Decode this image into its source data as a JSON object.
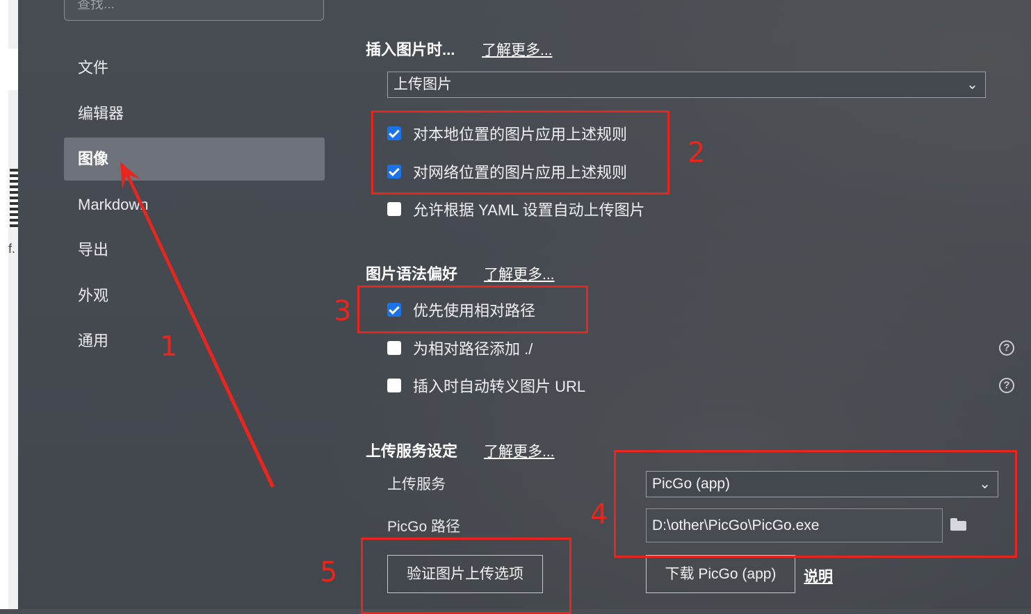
{
  "search": {
    "placeholder": "查找..."
  },
  "sidebar": {
    "items": [
      {
        "label": "文件",
        "active": false
      },
      {
        "label": "编辑器",
        "active": false
      },
      {
        "label": "图像",
        "active": true
      },
      {
        "label": "Markdown",
        "active": false
      },
      {
        "label": "导出",
        "active": false
      },
      {
        "label": "外观",
        "active": false
      },
      {
        "label": "通用",
        "active": false
      }
    ]
  },
  "insert_image": {
    "title": "插入图片时...",
    "learn_more": "了解更多...",
    "action_select": "上传图片",
    "options": [
      {
        "label": "对本地位置的图片应用上述规则",
        "checked": true
      },
      {
        "label": "对网络位置的图片应用上述规则",
        "checked": true
      },
      {
        "label": "允许根据 YAML 设置自动上传图片",
        "checked": false
      }
    ]
  },
  "syntax_pref": {
    "title": "图片语法偏好",
    "learn_more": "了解更多...",
    "options": [
      {
        "label": "优先使用相对路径",
        "checked": true,
        "help": false
      },
      {
        "label": "为相对路径添加 ./",
        "checked": false,
        "help": true
      },
      {
        "label": "插入时自动转义图片 URL",
        "checked": false,
        "help": true
      }
    ]
  },
  "upload_service": {
    "title": "上传服务设定",
    "learn_more": "了解更多...",
    "service_label": "上传服务",
    "service_value": "PicGo (app)",
    "path_label": "PicGo 路径",
    "path_value": "D:\\other\\PicGo\\PicGo.exe",
    "verify_button": "验证图片上传选项",
    "download_button": "下载 PicGo (app)",
    "docs_link": "说明"
  },
  "icons": {
    "chevron": "chevron-down-icon",
    "folder": "folder-icon",
    "help": "help-icon"
  },
  "annotations": {
    "color": "#e8261e",
    "numbers": [
      "1",
      "2",
      "3",
      "4",
      "5"
    ]
  },
  "colors": {
    "background": "#474c53",
    "active_nav": "#6e737b",
    "checkbox_on": "#1a73e8"
  }
}
